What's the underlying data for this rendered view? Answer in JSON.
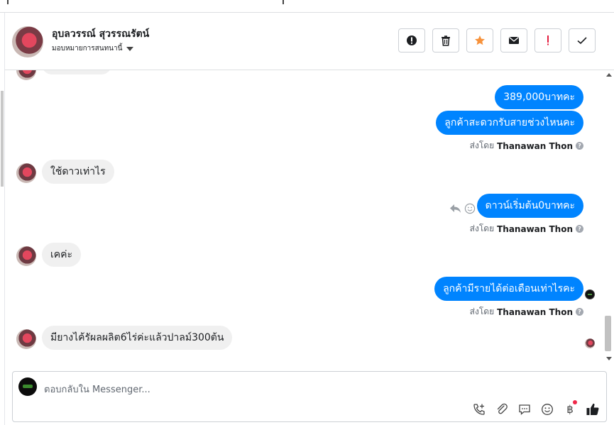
{
  "header": {
    "contact_name": "อุบลวรรณ์ สุวรรณรัตน์",
    "assign_label": "มอบหมายการสนทนานี้"
  },
  "actions": [
    {
      "name": "alert-button",
      "icon": "exclamation-circle-icon"
    },
    {
      "name": "delete-button",
      "icon": "trash-icon"
    },
    {
      "name": "star-button",
      "icon": "star-icon",
      "color": "#f7923b"
    },
    {
      "name": "mark-unread-button",
      "icon": "envelope-icon"
    },
    {
      "name": "important-button",
      "icon": "red-exclamation-icon",
      "color": "#e41e3f"
    },
    {
      "name": "mark-done-button",
      "icon": "check-icon"
    }
  ],
  "messages": {
    "out_price": "389,000บาทคะ",
    "out_question": "ลูกค้าสะดวกรับสายช่วงไหนคะ",
    "in_downpayment": "ใช้ดาวเท่าไร",
    "out_down": "ดาวน์เริ่มต้น0บาทคะ",
    "in_ok": "เคค่ะ",
    "out_income": "ลูกค้ามีรายได้ต่อเดือนเท่าไรคะ",
    "in_rubber": "มียางไค้รัผลผลิต6ไร่ค่ะแล้วปาลม์300ต้น"
  },
  "sent_by": {
    "prefix": "ส่งโดย",
    "agent": "Thanawan Thon"
  },
  "composer": {
    "placeholder": "ตอบกลับใน Messenger...",
    "currency_symbol": "฿"
  },
  "colors": {
    "outgoing_bubble": "#0084ff",
    "incoming_bubble": "#f0f0f0"
  }
}
